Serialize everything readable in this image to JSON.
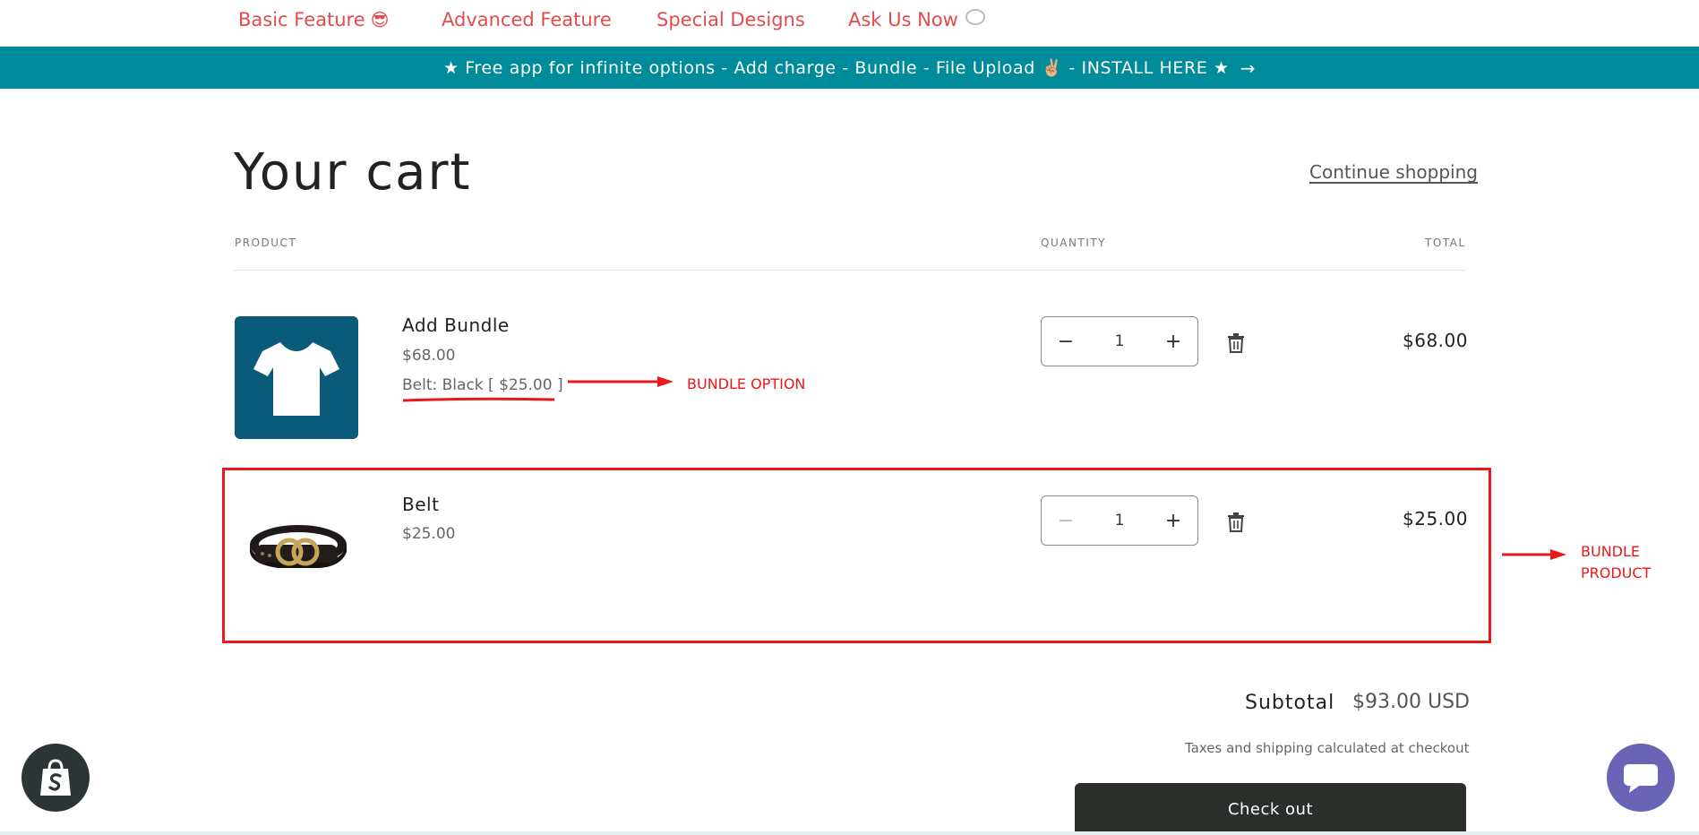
{
  "nav": {
    "items": [
      {
        "label": "Basic Feature",
        "emoji": "😎"
      },
      {
        "label": "Advanced Feature"
      },
      {
        "label": "Special Designs"
      },
      {
        "label": "Ask Us Now"
      }
    ]
  },
  "banner": {
    "text": "★ Free app for infinite options - Add charge - Bundle - File Upload ✌🏼 - INSTALL HERE ★",
    "arrow": "→"
  },
  "cart": {
    "title": "Your cart",
    "continue_label": "Continue shopping",
    "headers": {
      "product": "PRODUCT",
      "quantity": "QUANTITY",
      "total": "TOTAL"
    },
    "items": [
      {
        "name": "Add Bundle",
        "price": "$68.00",
        "option": "Belt: Black [ $25.00 ]",
        "qty": "1",
        "total": "$68.00",
        "image_icon": "tshirt-icon"
      },
      {
        "name": "Belt",
        "price": "$25.00",
        "qty": "1",
        "total": "$25.00",
        "image_icon": "belt-icon"
      }
    ],
    "subtotal_label": "Subtotal",
    "subtotal_value": "$93.00 USD",
    "taxes_note": "Taxes and shipping calculated at checkout",
    "checkout_label": "Check out"
  },
  "annotations": {
    "bundle_option": "BUNDLE OPTION",
    "bundle_product_line1": "BUNDLE",
    "bundle_product_line2": "PRODUCT"
  },
  "colors": {
    "accent_nav": "#e24c4c",
    "banner": "#008b9a",
    "annotation_red": "#e8181b",
    "checkout_bg": "#2a2f2c",
    "chat_badge": "#6b63b5"
  }
}
